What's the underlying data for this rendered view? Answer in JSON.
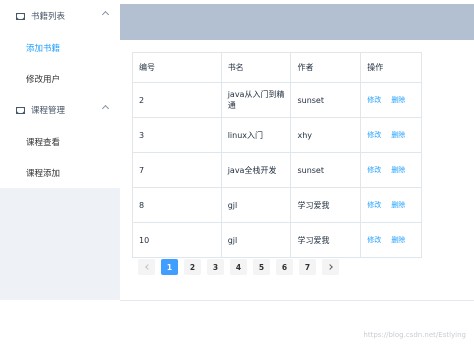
{
  "sidebar": {
    "groups": [
      {
        "title": "书籍列表",
        "items": [
          "添加书籍",
          "修改用户"
        ]
      },
      {
        "title": "课程管理",
        "items": [
          "课程查看",
          "课程添加"
        ]
      }
    ]
  },
  "table": {
    "headers": [
      "编号",
      "书名",
      "作者",
      "操作"
    ],
    "rows": [
      {
        "id": "2",
        "name": "java从入门到精通",
        "author": "sunset"
      },
      {
        "id": "3",
        "name": "linux入门",
        "author": "xhy"
      },
      {
        "id": "7",
        "name": "java全栈开发",
        "author": "sunset"
      },
      {
        "id": "8",
        "name": "gjl",
        "author": "学习爱我"
      },
      {
        "id": "10",
        "name": "gjl",
        "author": "学习爱我"
      }
    ],
    "edit_label": "修改",
    "delete_label": "删除"
  },
  "pagination": {
    "pages": [
      "1",
      "2",
      "3",
      "4",
      "5",
      "6",
      "7"
    ],
    "current": "1"
  },
  "watermark": "https://blog.csdn.net/Estlying"
}
